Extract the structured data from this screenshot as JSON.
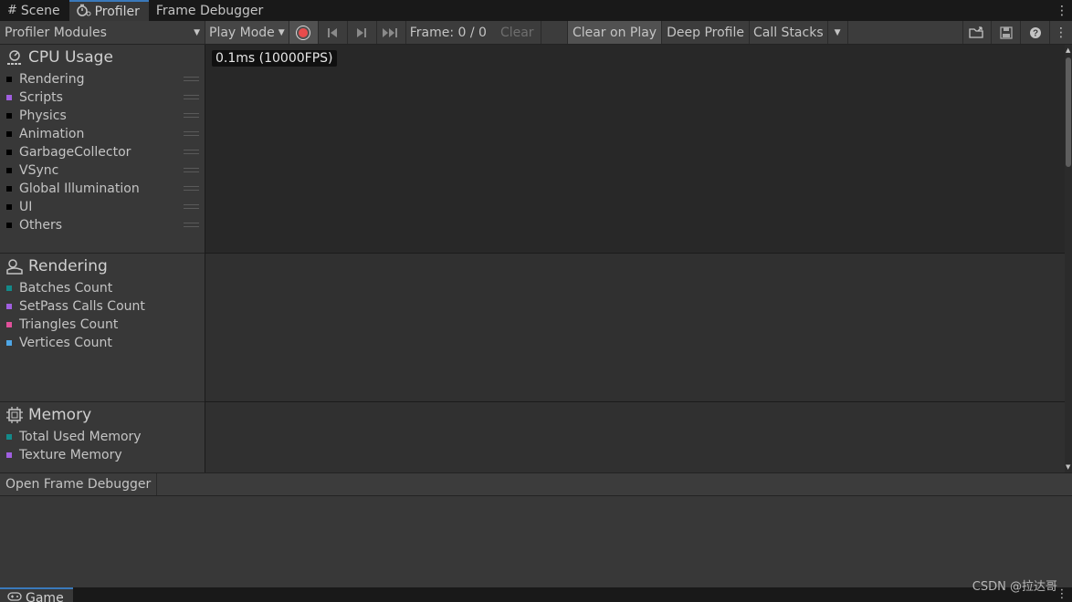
{
  "tabs": [
    {
      "label": "Scene",
      "icon": "grid-icon",
      "active": false
    },
    {
      "label": "Profiler",
      "icon": "stopwatch-icon",
      "active": true
    },
    {
      "label": "Frame Debugger",
      "icon": "",
      "active": false
    }
  ],
  "toolbar": {
    "modules_label": "Profiler Modules",
    "play_mode_label": "Play Mode",
    "frame_label": "Frame: 0 / 0",
    "clear_label": "Clear",
    "clear_on_play_label": "Clear on Play",
    "deep_profile_label": "Deep Profile",
    "call_stacks_label": "Call Stacks"
  },
  "modules": [
    {
      "title": "CPU Usage",
      "icon": "cpu-icon",
      "items": [
        {
          "label": "Rendering",
          "color": "#000000"
        },
        {
          "label": "Scripts",
          "color": "#a05fe0"
        },
        {
          "label": "Physics",
          "color": "#000000"
        },
        {
          "label": "Animation",
          "color": "#000000"
        },
        {
          "label": "GarbageCollector",
          "color": "#000000"
        },
        {
          "label": "VSync",
          "color": "#000000"
        },
        {
          "label": "Global Illumination",
          "color": "#000000"
        },
        {
          "label": "UI",
          "color": "#000000"
        },
        {
          "label": "Others",
          "color": "#000000"
        }
      ]
    },
    {
      "title": "Rendering",
      "icon": "rendering-icon",
      "items": [
        {
          "label": "Batches Count",
          "color": "#138a8a"
        },
        {
          "label": "SetPass Calls Count",
          "color": "#a05fe0"
        },
        {
          "label": "Triangles Count",
          "color": "#e0509a"
        },
        {
          "label": "Vertices Count",
          "color": "#4ea6e6"
        }
      ]
    },
    {
      "title": "Memory",
      "icon": "chip-icon",
      "items": [
        {
          "label": "Total Used Memory",
          "color": "#138a8a"
        },
        {
          "label": "Texture Memory",
          "color": "#a05fe0"
        }
      ]
    }
  ],
  "cpu_graph": {
    "fps_label": "0.1ms (10000FPS)"
  },
  "details_bar": {
    "open_frame_debugger_label": "Open Frame Debugger"
  },
  "bottom_tabs": [
    {
      "label": "Game",
      "icon": "gamepad-icon"
    }
  ],
  "watermark": "CSDN @拉达哥"
}
